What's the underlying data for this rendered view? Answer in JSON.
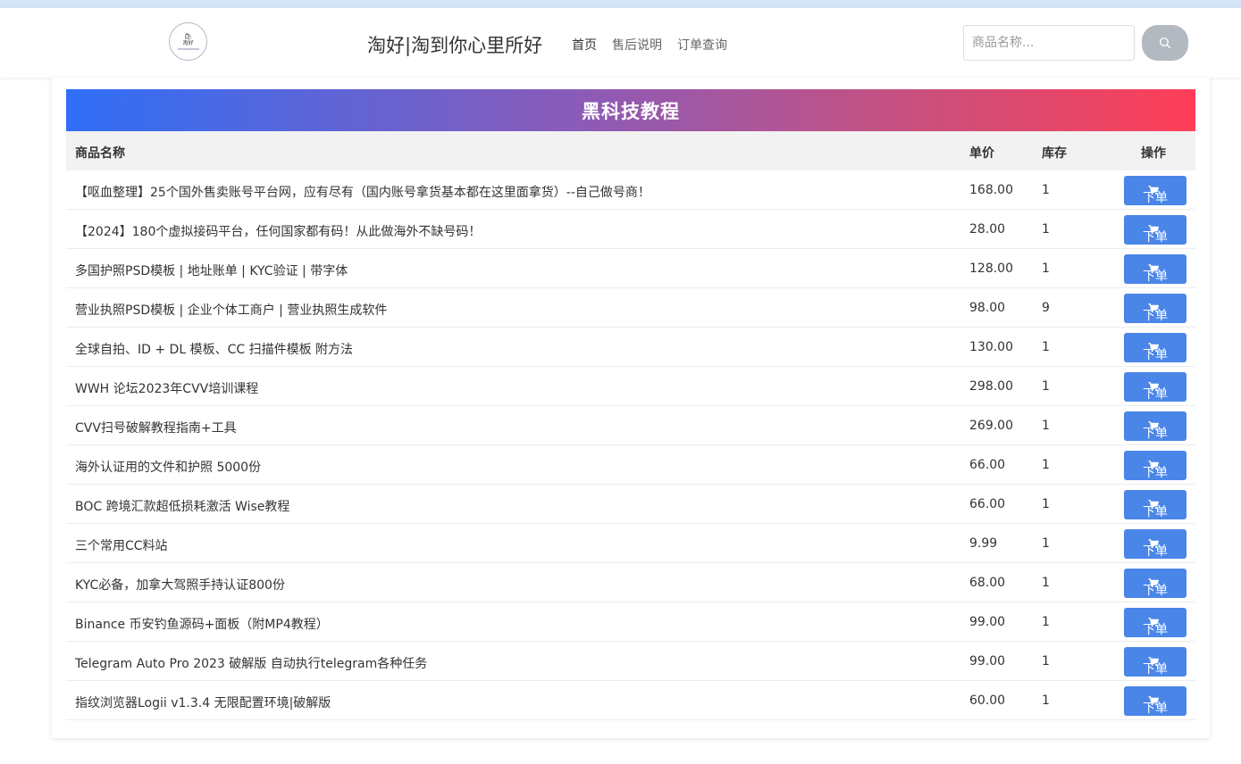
{
  "header": {
    "logo_mark": "🛍",
    "logo_text": "淘好",
    "site_title": "淘好|淘到你心里所好",
    "nav": [
      {
        "label": "首页"
      },
      {
        "label": "售后说明"
      },
      {
        "label": "订单查询"
      }
    ],
    "search_placeholder": "商品名称...",
    "search_icon": "search-icon"
  },
  "category": {
    "title": "黑科技教程"
  },
  "table": {
    "columns": [
      "商品名称",
      "单价",
      "库存",
      "操作"
    ],
    "order_label": "下单",
    "order_icon": "cart-icon",
    "rows": [
      {
        "name": "【呕血整理】25个国外售卖账号平台网，应有尽有（国内账号拿货基本都在这里面拿货）--自己做号商！",
        "price": "168.00",
        "stock": "1"
      },
      {
        "name": "【2024】180个虚拟接码平台，任何国家都有码！从此做海外不缺号码！",
        "price": "28.00",
        "stock": "1"
      },
      {
        "name": "多国护照PSD模板 | 地址账单 | KYC验证 | 带字体",
        "price": "128.00",
        "stock": "1"
      },
      {
        "name": "营业执照PSD模板 | 企业个体工商户 | 营业执照生成软件",
        "price": "98.00",
        "stock": "9"
      },
      {
        "name": "全球自拍、ID + DL 模板、CC 扫描件模板 附方法",
        "price": "130.00",
        "stock": "1"
      },
      {
        "name": "WWH 论坛2023年CVV培训课程",
        "price": "298.00",
        "stock": "1"
      },
      {
        "name": "CVV扫号破解教程指南+工具",
        "price": "269.00",
        "stock": "1"
      },
      {
        "name": "海外认证用的文件和护照 5000份",
        "price": "66.00",
        "stock": "1"
      },
      {
        "name": "BOC 跨境汇款超低损耗激活 Wise教程",
        "price": "66.00",
        "stock": "1"
      },
      {
        "name": "三个常用CC料站",
        "price": "9.99",
        "stock": "1"
      },
      {
        "name": "KYC必备，加拿大驾照手持认证800份",
        "price": "68.00",
        "stock": "1"
      },
      {
        "name": "Binance 币安钓鱼源码+面板（附MP4教程）",
        "price": "99.00",
        "stock": "1"
      },
      {
        "name": "Telegram Auto Pro 2023 破解版 自动执行telegram各种任务",
        "price": "99.00",
        "stock": "1"
      },
      {
        "name": "指纹浏览器Logii v1.3.4 无限配置环境|破解版",
        "price": "60.00",
        "stock": "1"
      }
    ]
  }
}
